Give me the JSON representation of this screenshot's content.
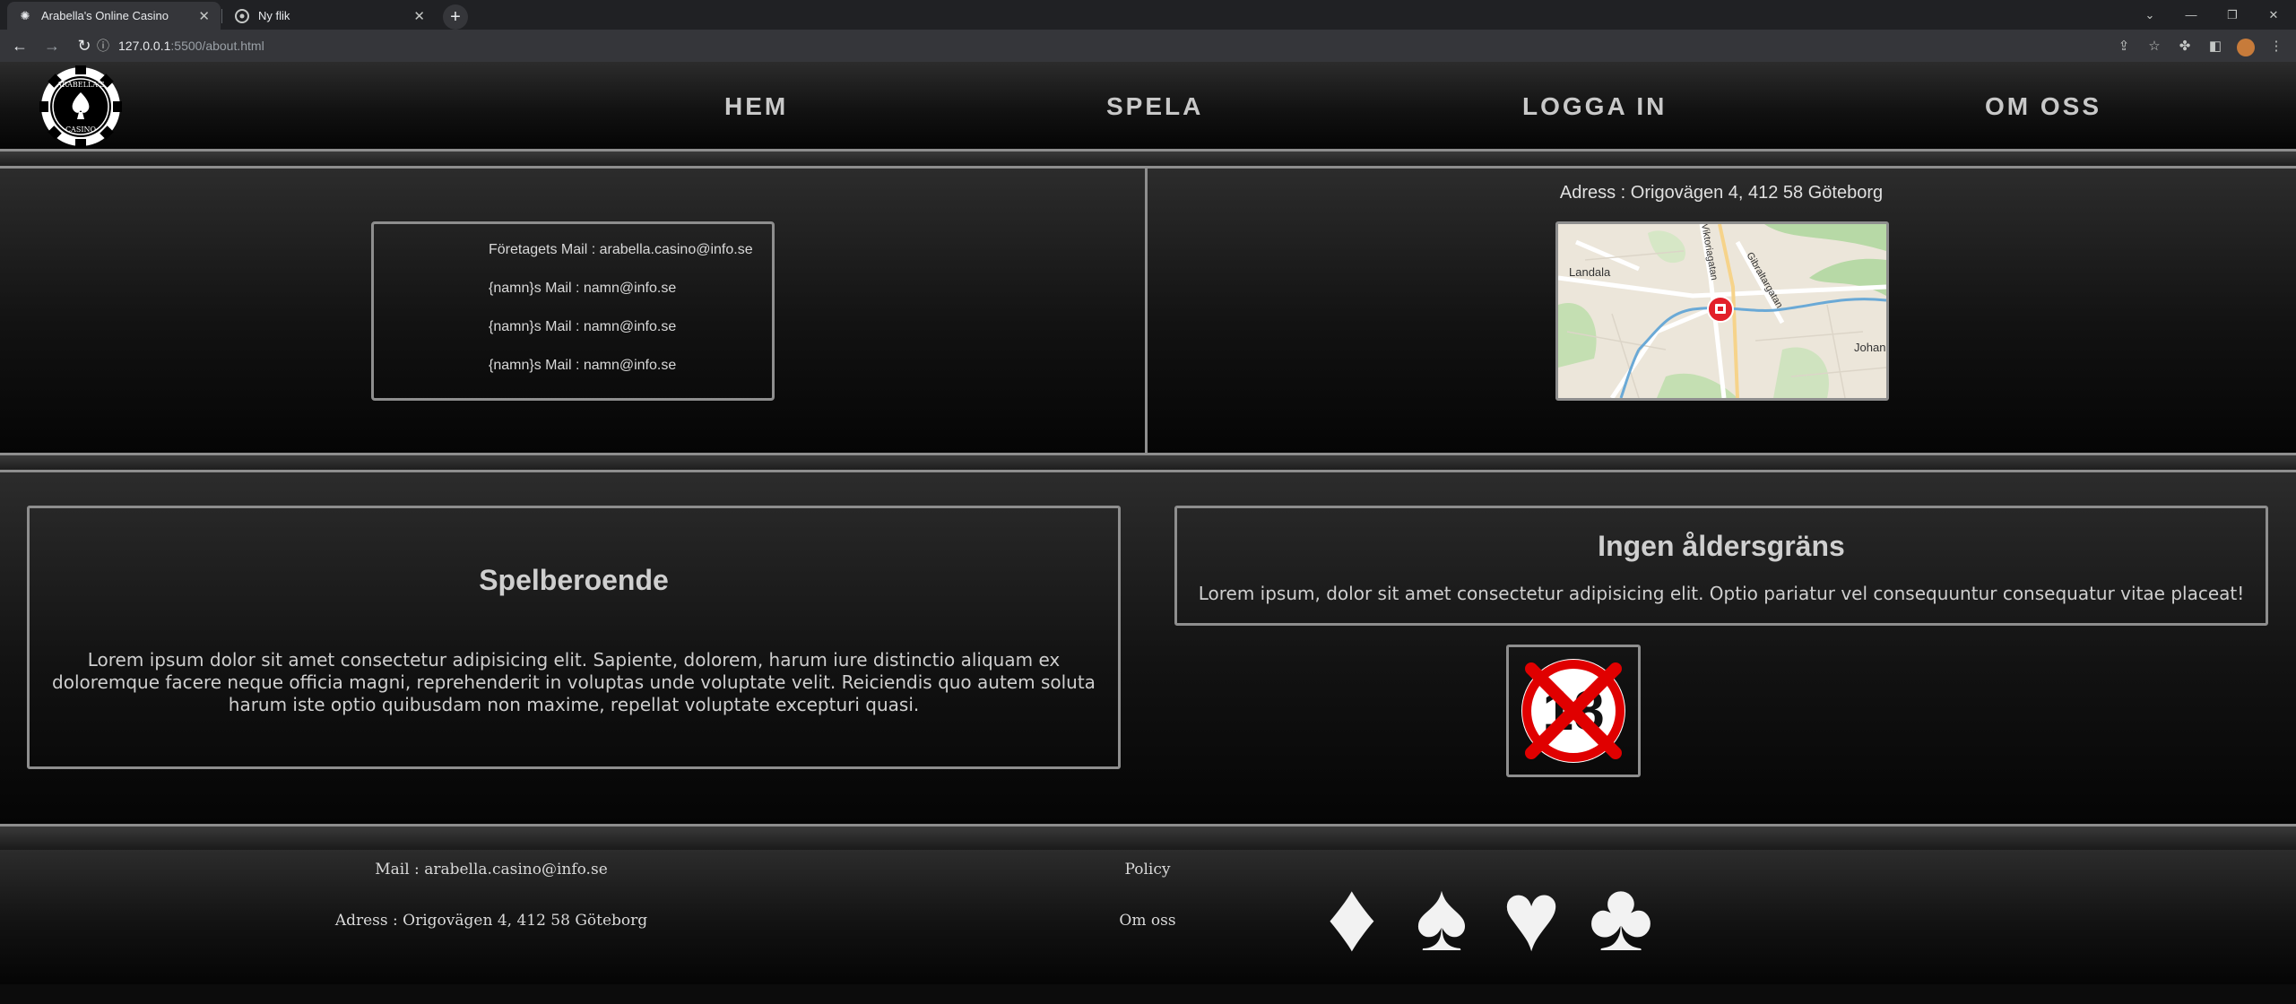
{
  "browser": {
    "tabs": [
      {
        "title": "Arabella's Online Casino",
        "active": true
      },
      {
        "title": "Ny flik",
        "active": false
      }
    ],
    "url_host": "127.0.0.1",
    "url_path": ":5500/about.html"
  },
  "logo": {
    "text_top": "ARABELLA'S",
    "text_bottom": "CASINO"
  },
  "nav": {
    "home": "HEM",
    "play": "SPELA",
    "login": "LOGGA IN",
    "about": "OM OSS"
  },
  "contact": {
    "mails": [
      "Företagets Mail : arabella.casino@info.se",
      "{namn}s Mail : namn@info.se",
      "{namn}s Mail : namn@info.se",
      "{namn}s Mail : namn@info.se"
    ],
    "address": "Adress : Origovägen 4, 412 58 Göteborg",
    "map_labels": [
      "Landala",
      "Johan",
      "Gibraltargatan",
      "Viktoriagatan"
    ]
  },
  "addiction": {
    "title": "Spelberoende",
    "text": "Lorem ipsum dolor sit amet consectetur adipisicing elit. Sapiente, dolorem, harum iure distinctio aliquam ex doloremque facere neque officia magni, reprehenderit in voluptas unde voluptate velit. Reiciendis quo autem soluta harum iste optio quibusdam non maxime, repellat voluptate excepturi quasi."
  },
  "age": {
    "title": "Ingen åldersgräns",
    "text": "Lorem ipsum, dolor sit amet consectetur adipisicing elit. Optio pariatur vel consequuntur consequatur vitae placeat!",
    "badge_number": "18"
  },
  "footer": {
    "mail": "Mail : arabella.casino@info.se",
    "address": "Adress : Origovägen 4, 412 58 Göteborg",
    "policy": "Policy",
    "about": "Om oss",
    "suits": [
      "♦",
      "♠",
      "♥",
      "♣"
    ]
  },
  "colors": {
    "accent_border": "#8e8e8e",
    "map_pin": "#e2202a",
    "age_cross": "#e00000"
  }
}
